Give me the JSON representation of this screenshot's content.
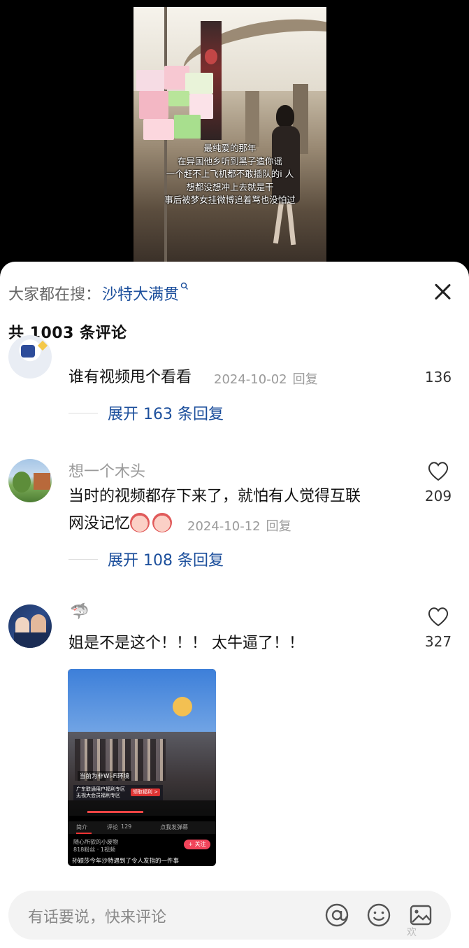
{
  "video": {
    "subtitle_lines": [
      "最纯爱的那年",
      "在异国他乡听到黑子造你谣",
      "一个赶不上飞机都不敢插队的i 人",
      "想都没想冲上去就是干",
      "事后被梦女挂微博追着骂也没怕过"
    ]
  },
  "sheet": {
    "search_label": "大家都在搜：",
    "search_term": "沙特大满贯",
    "search_icon": "search-icon",
    "close_icon": "close-icon",
    "comment_count": "共 1003 条评论"
  },
  "comments": [
    {
      "text": "谁有视频甩个看看",
      "date": "2024-10-02",
      "reply": "回复",
      "likes": "136",
      "expand": "展开 163 条回复"
    },
    {
      "name": "想一个木头",
      "text_line1": "当时的视频都存下来了，就怕有人觉得互联",
      "text_line2": "网没记忆",
      "date": "2024-10-12",
      "reply": "回复",
      "likes": "209",
      "expand": "展开 108 条回复"
    },
    {
      "name": "🦈",
      "text": "姐是不是这个！！！ 太牛逼了！！",
      "likes": "327",
      "embed": {
        "wifi_text": "当前为非Wi-Fi环境",
        "promo_title": "广东联通用户福利专区",
        "promo_sub": "无视大会员福利专区",
        "promo_btn": "领取福利 >",
        "tab1": "简介",
        "tab2": "评论",
        "tab2_count": "129",
        "tab3": "点我发弹幕",
        "user": "随心所欲的小废物",
        "user_sub": "818粉丝 · 1视频",
        "follow": "+ 关注",
        "caption": "孙颖莎今年沙特遇到了令人发指的一件事"
      }
    }
  ],
  "input": {
    "placeholder": "有话要说，快来评论",
    "mention_icon": "at-icon",
    "emoji_icon": "emoji-icon",
    "image_icon": "image-icon"
  },
  "watermark": "欢"
}
